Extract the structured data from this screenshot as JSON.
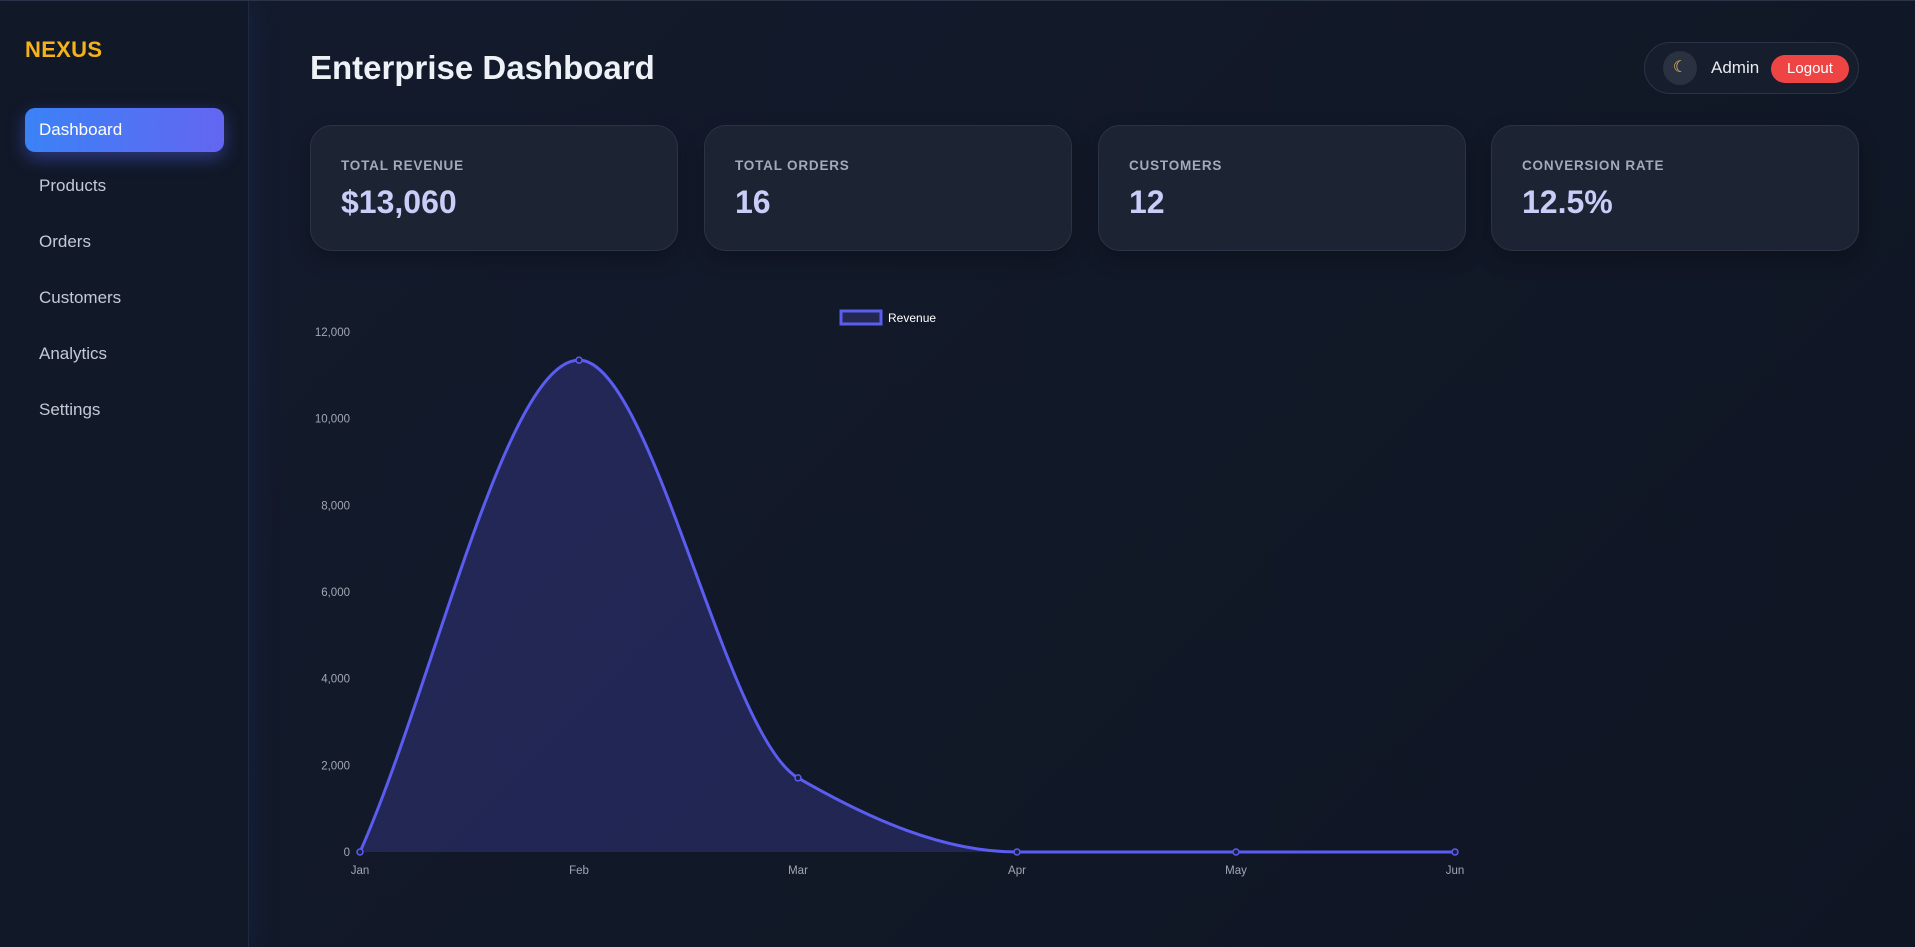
{
  "app": {
    "logo": "NEXUS",
    "page_title": "Enterprise Dashboard"
  },
  "sidebar": {
    "items": [
      {
        "label": "Dashboard",
        "active": true
      },
      {
        "label": "Products",
        "active": false
      },
      {
        "label": "Orders",
        "active": false
      },
      {
        "label": "Customers",
        "active": false
      },
      {
        "label": "Analytics",
        "active": false
      },
      {
        "label": "Settings",
        "active": false
      }
    ]
  },
  "header": {
    "theme_icon": "moon-icon",
    "user_name": "Admin",
    "logout_label": "Logout"
  },
  "stats": [
    {
      "label": "TOTAL REVENUE",
      "value": "$13,060"
    },
    {
      "label": "TOTAL ORDERS",
      "value": "16"
    },
    {
      "label": "CUSTOMERS",
      "value": "12"
    },
    {
      "label": "CONVERSION RATE",
      "value": "12.5%"
    }
  ],
  "colors": {
    "accent": "#6366f1",
    "logo": "#f5b21b",
    "logout": "#ef4444",
    "line": "#5b5cf0"
  },
  "chart_data": {
    "type": "area",
    "categories": [
      "Jan",
      "Feb",
      "Mar",
      "Apr",
      "May",
      "Jun"
    ],
    "series": [
      {
        "name": "Revenue",
        "values": [
          0,
          11350,
          1710,
          0,
          0,
          0
        ]
      }
    ],
    "y_ticks": [
      "0",
      "2,000",
      "4,000",
      "6,000",
      "8,000",
      "10,000",
      "12,000"
    ],
    "ylim": [
      0,
      12000
    ],
    "legend": "top-center",
    "grid": false
  }
}
